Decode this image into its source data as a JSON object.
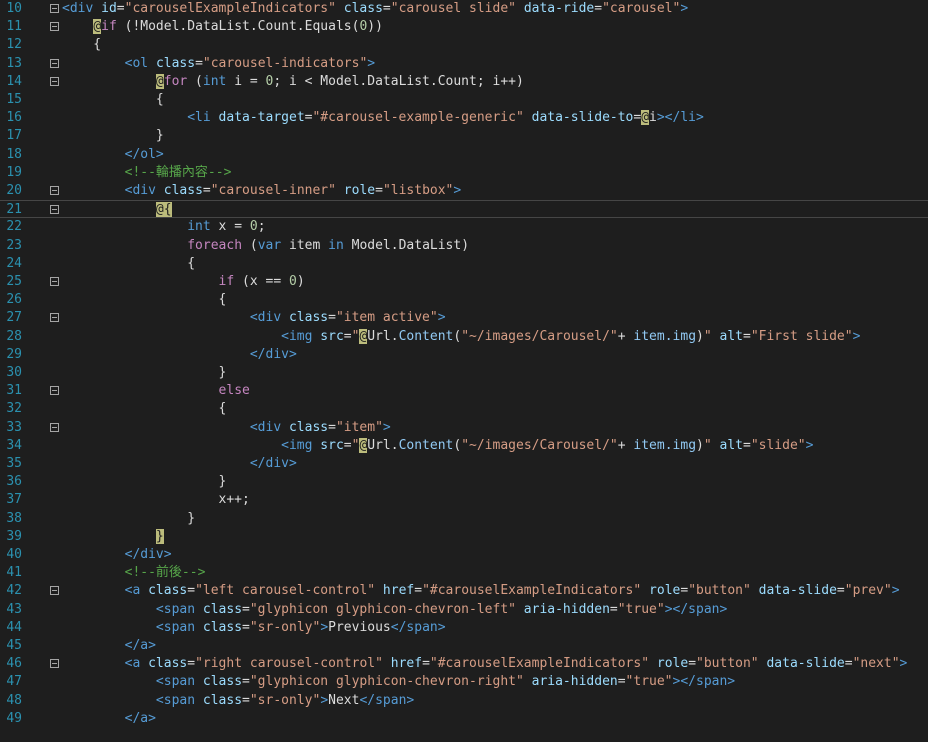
{
  "editor": {
    "lines": [
      {
        "n": "10",
        "fold": true,
        "current": false,
        "segs": [
          [
            "tag",
            "<div "
          ],
          [
            "attr",
            "id"
          ],
          [
            "text",
            "="
          ],
          [
            "str",
            "\"carouselExampleIndicators\""
          ],
          [
            "text",
            " "
          ],
          [
            "attr",
            "class"
          ],
          [
            "text",
            "="
          ],
          [
            "str",
            "\"carousel slide\""
          ],
          [
            "text",
            " "
          ],
          [
            "attr",
            "data-ride"
          ],
          [
            "text",
            "="
          ],
          [
            "str",
            "\"carousel\""
          ],
          [
            "tag",
            ">"
          ]
        ]
      },
      {
        "n": "11",
        "fold": true,
        "current": false,
        "segs": [
          [
            "text",
            "    "
          ],
          [
            "razor",
            "@"
          ],
          [
            "kw",
            "if"
          ],
          [
            "text",
            " (!Model.DataList.Count.Equals("
          ],
          [
            "num",
            "0"
          ],
          [
            "text",
            "))"
          ]
        ]
      },
      {
        "n": "12",
        "fold": false,
        "current": false,
        "segs": [
          [
            "text",
            "    {"
          ]
        ]
      },
      {
        "n": "13",
        "fold": true,
        "current": false,
        "segs": [
          [
            "text",
            "        "
          ],
          [
            "tag",
            "<ol "
          ],
          [
            "attr",
            "class"
          ],
          [
            "text",
            "="
          ],
          [
            "str",
            "\"carousel-indicators\""
          ],
          [
            "tag",
            ">"
          ]
        ]
      },
      {
        "n": "14",
        "fold": true,
        "current": false,
        "segs": [
          [
            "text",
            "            "
          ],
          [
            "razor",
            "@"
          ],
          [
            "kw",
            "for"
          ],
          [
            "text",
            " ("
          ],
          [
            "kwblue",
            "int"
          ],
          [
            "text",
            " i = "
          ],
          [
            "num",
            "0"
          ],
          [
            "text",
            "; i < Model.DataList.Count; i++)"
          ]
        ]
      },
      {
        "n": "15",
        "fold": false,
        "current": false,
        "segs": [
          [
            "text",
            "            {"
          ]
        ]
      },
      {
        "n": "16",
        "fold": false,
        "current": false,
        "segs": [
          [
            "text",
            "                "
          ],
          [
            "tag",
            "<li "
          ],
          [
            "attr",
            "data-target"
          ],
          [
            "text",
            "="
          ],
          [
            "str",
            "\"#carousel-example-generic\""
          ],
          [
            "text",
            " "
          ],
          [
            "attr",
            "data-slide-to"
          ],
          [
            "text",
            "="
          ],
          [
            "razor",
            "@"
          ],
          [
            "text",
            "i"
          ],
          [
            "tag",
            "></li>"
          ]
        ]
      },
      {
        "n": "17",
        "fold": false,
        "current": false,
        "segs": [
          [
            "text",
            "            }"
          ]
        ]
      },
      {
        "n": "18",
        "fold": false,
        "current": false,
        "segs": [
          [
            "text",
            "        "
          ],
          [
            "tag",
            "</ol>"
          ]
        ]
      },
      {
        "n": "19",
        "fold": false,
        "current": false,
        "segs": [
          [
            "text",
            "        "
          ],
          [
            "comment",
            "<!--輪播內容-->"
          ]
        ]
      },
      {
        "n": "20",
        "fold": true,
        "current": false,
        "segs": [
          [
            "text",
            "        "
          ],
          [
            "tag",
            "<div "
          ],
          [
            "attr",
            "class"
          ],
          [
            "text",
            "="
          ],
          [
            "str",
            "\"carousel-inner\""
          ],
          [
            "text",
            " "
          ],
          [
            "attr",
            "role"
          ],
          [
            "text",
            "="
          ],
          [
            "str",
            "\"listbox\""
          ],
          [
            "tag",
            ">"
          ]
        ]
      },
      {
        "n": "21",
        "fold": true,
        "current": true,
        "segs": [
          [
            "text",
            "            "
          ],
          [
            "razor",
            "@{"
          ]
        ]
      },
      {
        "n": "22",
        "fold": false,
        "current": false,
        "segs": [
          [
            "text",
            "                "
          ],
          [
            "kwblue",
            "int"
          ],
          [
            "text",
            " x = "
          ],
          [
            "num",
            "0"
          ],
          [
            "text",
            ";"
          ]
        ]
      },
      {
        "n": "23",
        "fold": false,
        "current": false,
        "segs": [
          [
            "text",
            "                "
          ],
          [
            "kw",
            "foreach"
          ],
          [
            "text",
            " ("
          ],
          [
            "kwblue",
            "var"
          ],
          [
            "text",
            " item "
          ],
          [
            "kwblue",
            "in"
          ],
          [
            "text",
            " Model.DataList)"
          ]
        ]
      },
      {
        "n": "24",
        "fold": false,
        "current": false,
        "segs": [
          [
            "text",
            "                {"
          ]
        ]
      },
      {
        "n": "25",
        "fold": true,
        "current": false,
        "segs": [
          [
            "text",
            "                    "
          ],
          [
            "kw",
            "if"
          ],
          [
            "text",
            " (x == "
          ],
          [
            "num",
            "0"
          ],
          [
            "text",
            ")"
          ]
        ]
      },
      {
        "n": "26",
        "fold": false,
        "current": false,
        "segs": [
          [
            "text",
            "                    {"
          ]
        ]
      },
      {
        "n": "27",
        "fold": true,
        "current": false,
        "segs": [
          [
            "text",
            "                        "
          ],
          [
            "tag",
            "<div "
          ],
          [
            "attr",
            "class"
          ],
          [
            "text",
            "="
          ],
          [
            "str",
            "\"item active\""
          ],
          [
            "tag",
            ">"
          ]
        ]
      },
      {
        "n": "28",
        "fold": false,
        "current": false,
        "segs": [
          [
            "text",
            "                            "
          ],
          [
            "tag",
            "<img "
          ],
          [
            "attr",
            "src"
          ],
          [
            "text",
            "="
          ],
          [
            "str",
            "\""
          ],
          [
            "razor",
            "@"
          ],
          [
            "text",
            "Url."
          ],
          [
            "prop",
            "Content"
          ],
          [
            "text",
            "("
          ],
          [
            "str",
            "\"~/images/Carousel/\""
          ],
          [
            "text",
            "+ "
          ],
          [
            "prop",
            "item.img"
          ],
          [
            "text",
            ")"
          ],
          [
            "str",
            "\""
          ],
          [
            "text",
            " "
          ],
          [
            "attr",
            "alt"
          ],
          [
            "text",
            "="
          ],
          [
            "str",
            "\"First slide\""
          ],
          [
            "tag",
            ">"
          ]
        ]
      },
      {
        "n": "29",
        "fold": false,
        "current": false,
        "segs": [
          [
            "text",
            "                        "
          ],
          [
            "tag",
            "</div>"
          ]
        ]
      },
      {
        "n": "30",
        "fold": false,
        "current": false,
        "segs": [
          [
            "text",
            "                    }"
          ]
        ]
      },
      {
        "n": "31",
        "fold": true,
        "current": false,
        "segs": [
          [
            "text",
            "                    "
          ],
          [
            "kw",
            "else"
          ]
        ]
      },
      {
        "n": "32",
        "fold": false,
        "current": false,
        "segs": [
          [
            "text",
            "                    {"
          ]
        ]
      },
      {
        "n": "33",
        "fold": true,
        "current": false,
        "segs": [
          [
            "text",
            "                        "
          ],
          [
            "tag",
            "<div "
          ],
          [
            "attr",
            "class"
          ],
          [
            "text",
            "="
          ],
          [
            "str",
            "\"item\""
          ],
          [
            "tag",
            ">"
          ]
        ]
      },
      {
        "n": "34",
        "fold": false,
        "current": false,
        "segs": [
          [
            "text",
            "                            "
          ],
          [
            "tag",
            "<img "
          ],
          [
            "attr",
            "src"
          ],
          [
            "text",
            "="
          ],
          [
            "str",
            "\""
          ],
          [
            "razor",
            "@"
          ],
          [
            "text",
            "Url."
          ],
          [
            "prop",
            "Content"
          ],
          [
            "text",
            "("
          ],
          [
            "str",
            "\"~/images/Carousel/\""
          ],
          [
            "text",
            "+ "
          ],
          [
            "prop",
            "item.img"
          ],
          [
            "text",
            ")"
          ],
          [
            "str",
            "\""
          ],
          [
            "text",
            " "
          ],
          [
            "attr",
            "alt"
          ],
          [
            "text",
            "="
          ],
          [
            "str",
            "\"slide\""
          ],
          [
            "tag",
            ">"
          ]
        ]
      },
      {
        "n": "35",
        "fold": false,
        "current": false,
        "segs": [
          [
            "text",
            "                        "
          ],
          [
            "tag",
            "</div>"
          ]
        ]
      },
      {
        "n": "36",
        "fold": false,
        "current": false,
        "segs": [
          [
            "text",
            "                    }"
          ]
        ]
      },
      {
        "n": "37",
        "fold": false,
        "current": false,
        "segs": [
          [
            "text",
            "                    x++;"
          ]
        ]
      },
      {
        "n": "38",
        "fold": false,
        "current": false,
        "segs": [
          [
            "text",
            "                }"
          ]
        ]
      },
      {
        "n": "39",
        "fold": false,
        "current": false,
        "segs": [
          [
            "text",
            "            "
          ],
          [
            "razor",
            "}"
          ]
        ]
      },
      {
        "n": "40",
        "fold": false,
        "current": false,
        "segs": [
          [
            "text",
            "        "
          ],
          [
            "tag",
            "</div>"
          ]
        ]
      },
      {
        "n": "41",
        "fold": false,
        "current": false,
        "segs": [
          [
            "text",
            "        "
          ],
          [
            "comment",
            "<!--前後-->"
          ]
        ]
      },
      {
        "n": "42",
        "fold": true,
        "current": false,
        "segs": [
          [
            "text",
            "        "
          ],
          [
            "tag",
            "<a "
          ],
          [
            "attr",
            "class"
          ],
          [
            "text",
            "="
          ],
          [
            "str",
            "\"left carousel-control\""
          ],
          [
            "text",
            " "
          ],
          [
            "attr",
            "href"
          ],
          [
            "text",
            "="
          ],
          [
            "str",
            "\"#carouselExampleIndicators\""
          ],
          [
            "text",
            " "
          ],
          [
            "attr",
            "role"
          ],
          [
            "text",
            "="
          ],
          [
            "str",
            "\"button\""
          ],
          [
            "text",
            " "
          ],
          [
            "attr",
            "data-slide"
          ],
          [
            "text",
            "="
          ],
          [
            "str",
            "\"prev\""
          ],
          [
            "tag",
            ">"
          ]
        ]
      },
      {
        "n": "43",
        "fold": false,
        "current": false,
        "segs": [
          [
            "text",
            "            "
          ],
          [
            "tag",
            "<span "
          ],
          [
            "attr",
            "class"
          ],
          [
            "text",
            "="
          ],
          [
            "str",
            "\"glyphicon glyphicon-chevron-left\""
          ],
          [
            "text",
            " "
          ],
          [
            "attr",
            "aria-hidden"
          ],
          [
            "text",
            "="
          ],
          [
            "str",
            "\"true\""
          ],
          [
            "tag",
            "></span>"
          ]
        ]
      },
      {
        "n": "44",
        "fold": false,
        "current": false,
        "segs": [
          [
            "text",
            "            "
          ],
          [
            "tag",
            "<span "
          ],
          [
            "attr",
            "class"
          ],
          [
            "text",
            "="
          ],
          [
            "str",
            "\"sr-only\""
          ],
          [
            "tag",
            ">"
          ],
          [
            "text",
            "Previous"
          ],
          [
            "tag",
            "</span>"
          ]
        ]
      },
      {
        "n": "45",
        "fold": false,
        "current": false,
        "segs": [
          [
            "text",
            "        "
          ],
          [
            "tag",
            "</a>"
          ]
        ]
      },
      {
        "n": "46",
        "fold": true,
        "current": false,
        "segs": [
          [
            "text",
            "        "
          ],
          [
            "tag",
            "<a "
          ],
          [
            "attr",
            "class"
          ],
          [
            "text",
            "="
          ],
          [
            "str",
            "\"right carousel-control\""
          ],
          [
            "text",
            " "
          ],
          [
            "attr",
            "href"
          ],
          [
            "text",
            "="
          ],
          [
            "str",
            "\"#carouselExampleIndicators\""
          ],
          [
            "text",
            " "
          ],
          [
            "attr",
            "role"
          ],
          [
            "text",
            "="
          ],
          [
            "str",
            "\"button\""
          ],
          [
            "text",
            " "
          ],
          [
            "attr",
            "data-slide"
          ],
          [
            "text",
            "="
          ],
          [
            "str",
            "\"next\""
          ],
          [
            "tag",
            ">"
          ]
        ]
      },
      {
        "n": "47",
        "fold": false,
        "current": false,
        "segs": [
          [
            "text",
            "            "
          ],
          [
            "tag",
            "<span "
          ],
          [
            "attr",
            "class"
          ],
          [
            "text",
            "="
          ],
          [
            "str",
            "\"glyphicon glyphicon-chevron-right\""
          ],
          [
            "text",
            " "
          ],
          [
            "attr",
            "aria-hidden"
          ],
          [
            "text",
            "="
          ],
          [
            "str",
            "\"true\""
          ],
          [
            "tag",
            "></span>"
          ]
        ]
      },
      {
        "n": "48",
        "fold": false,
        "current": false,
        "segs": [
          [
            "text",
            "            "
          ],
          [
            "tag",
            "<span "
          ],
          [
            "attr",
            "class"
          ],
          [
            "text",
            "="
          ],
          [
            "str",
            "\"sr-only\""
          ],
          [
            "tag",
            ">"
          ],
          [
            "text",
            "Next"
          ],
          [
            "tag",
            "</span>"
          ]
        ]
      },
      {
        "n": "49",
        "fold": false,
        "current": false,
        "segs": [
          [
            "text",
            "        "
          ],
          [
            "tag",
            "</a>"
          ]
        ]
      }
    ]
  },
  "colors": {
    "background": "#1e1e1e",
    "line_number": "#2b91af",
    "tag": "#569cd6",
    "attribute": "#9cdcfe",
    "string": "#d69d85",
    "razor_highlight": "#bcbc7c",
    "comment": "#57a64a"
  }
}
